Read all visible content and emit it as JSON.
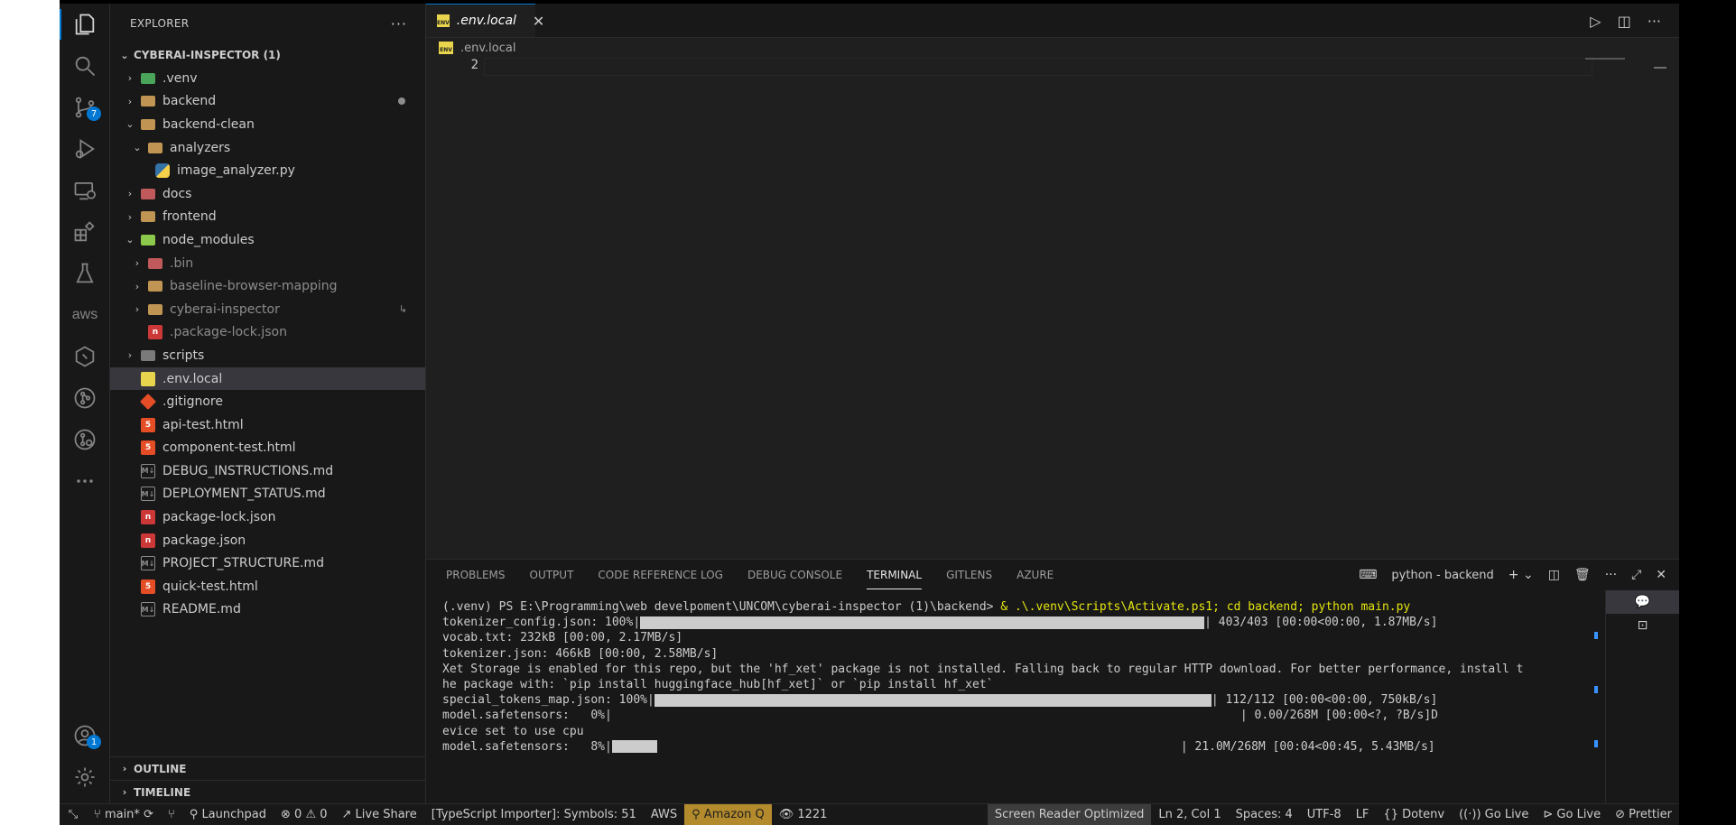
{
  "sidebar": {
    "title": "EXPLORER",
    "more": "···",
    "project": "CYBERAI-INSPECTOR (1)",
    "items": [
      {
        "label": ".venv",
        "indent": 0,
        "chev": "›",
        "icon": "venv"
      },
      {
        "label": "backend",
        "indent": 0,
        "chev": "›",
        "icon": "folder"
      },
      {
        "label": "backend-clean",
        "indent": 0,
        "chev": "⌄",
        "icon": "folder"
      },
      {
        "label": "analyzers",
        "indent": 1,
        "chev": "⌄",
        "icon": "folder"
      },
      {
        "label": "image_analyzer.py",
        "indent": 2,
        "chev": "",
        "icon": "python"
      },
      {
        "label": "docs",
        "indent": 0,
        "chev": "›",
        "icon": "docs"
      },
      {
        "label": "frontend",
        "indent": 0,
        "chev": "›",
        "icon": "folder"
      },
      {
        "label": "node_modules",
        "indent": 0,
        "chev": "⌄",
        "icon": "node"
      },
      {
        "label": ".bin",
        "indent": 1,
        "chev": "›",
        "icon": "bin"
      },
      {
        "label": "baseline-browser-mapping",
        "indent": 1,
        "chev": "›",
        "icon": "folder"
      },
      {
        "label": "cyberai-inspector",
        "indent": 1,
        "chev": "›",
        "icon": "folder"
      },
      {
        "label": ".package-lock.json",
        "indent": 1,
        "chev": "",
        "icon": "npm"
      },
      {
        "label": "scripts",
        "indent": 0,
        "chev": "›",
        "icon": "scripts"
      },
      {
        "label": ".env.local",
        "indent": 0,
        "chev": "",
        "icon": "env"
      },
      {
        "label": ".gitignore",
        "indent": 0,
        "chev": "",
        "icon": "git"
      },
      {
        "label": "api-test.html",
        "indent": 0,
        "chev": "",
        "icon": "html"
      },
      {
        "label": "component-test.html",
        "indent": 0,
        "chev": "",
        "icon": "html"
      },
      {
        "label": "DEBUG_INSTRUCTIONS.md",
        "indent": 0,
        "chev": "",
        "icon": "md"
      },
      {
        "label": "DEPLOYMENT_STATUS.md",
        "indent": 0,
        "chev": "",
        "icon": "md"
      },
      {
        "label": "package-lock.json",
        "indent": 0,
        "chev": "",
        "icon": "npm"
      },
      {
        "label": "package.json",
        "indent": 0,
        "chev": "",
        "icon": "npm"
      },
      {
        "label": "PROJECT_STRUCTURE.md",
        "indent": 0,
        "chev": "",
        "icon": "md"
      },
      {
        "label": "quick-test.html",
        "indent": 0,
        "chev": "",
        "icon": "html"
      },
      {
        "label": "README.md",
        "indent": 0,
        "chev": "",
        "icon": "md"
      }
    ],
    "outline": "OUTLINE",
    "timeline": "TIMELINE"
  },
  "activity": {
    "source_control_badge": "7",
    "accounts_badge": "1",
    "aws_label": "aws"
  },
  "editor": {
    "tab_label": ".env.local",
    "tab_close": "✕",
    "env_icon_text": "ENV",
    "breadcrumb": ".env.local",
    "line_number": "2"
  },
  "panel": {
    "tabs": [
      "PROBLEMS",
      "OUTPUT",
      "CODE REFERENCE LOG",
      "DEBUG CONSOLE",
      "TERMINAL",
      "GITLENS",
      "AZURE"
    ],
    "terminal_name": "python - backend",
    "lines": {
      "prompt": "(.venv) PS E:\\Programming\\web develpoment\\UNCOM\\cyberai-inspector (1)\\backend> ",
      "command": "& .\\.venv\\Scripts\\Activate.ps1; cd backend; python main.py",
      "l1_left": "tokenizer_config.json: 100%|",
      "l1_right": "| 403/403 [00:00<00:00, 1.87MB/s]",
      "l2": "vocab.txt: 232kB [00:00, 2.17MB/s]",
      "l3": "tokenizer.json: 466kB [00:00, 2.58MB/s]",
      "l4": "Xet Storage is enabled for this repo, but the 'hf_xet' package is not installed. Falling back to regular HTTP download. For better performance, install t",
      "l5": "he package with: `pip install huggingface_hub[hf_xet]` or `pip install hf_xet`",
      "l6_left": "special_tokens_map.json: 100%|",
      "l6_right": "| 112/112 [00:00<00:00, 750kB/s]",
      "l7_left": "model.safetensors:   0%|",
      "l7_right": "| 0.00/268M [00:00<?, ?B/s]D",
      "l8": "evice set to use cpu",
      "l9_left": "model.safetensors:   8%|",
      "l9_right": "| 21.0M/268M [00:04<00:45, 5.43MB/s]"
    },
    "progress": {
      "tokenizer_config": 1.0,
      "special_tokens_map": 1.0,
      "model_safetensors": 0.08
    }
  },
  "statusbar": {
    "branch": "main*",
    "launchpad": "Launchpad",
    "errors": "0",
    "warnings": "0",
    "live_share": "Live Share",
    "ts_importer": "[TypeScript Importer]: Symbols: 51",
    "aws": "AWS",
    "amazon_q": "Amazon Q",
    "views": "1221",
    "screen_reader": "Screen Reader Optimized",
    "position": "Ln 2, Col 1",
    "spaces": "Spaces: 4",
    "encoding": "UTF-8",
    "eol": "LF",
    "language": "Dotenv",
    "go_live_1": "Go Live",
    "go_live_2": "Go Live",
    "prettier": "Prettier"
  },
  "colors": {
    "accent": "#0078d4",
    "amazon_q_bg": "#b38b2d",
    "folder": "#c09553",
    "html": "#e44d26",
    "npm": "#cb3837",
    "python": "#3572A5",
    "env": "#e8d44d"
  }
}
